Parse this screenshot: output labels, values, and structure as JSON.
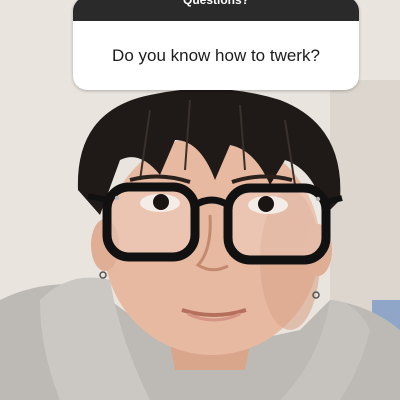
{
  "question_sticker": {
    "header": "Questions?",
    "question": "Do you know how to twerk?"
  },
  "colors": {
    "header_bg": "#2a2a2a",
    "card_bg": "#ffffff",
    "wall": "#e9e4de",
    "hoodie": "#bdbab6",
    "hair": "#1f1a18",
    "skin": "#e7b9a0"
  }
}
